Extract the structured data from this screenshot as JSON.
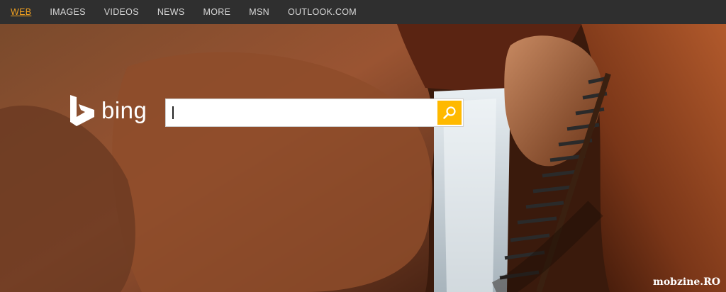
{
  "nav": {
    "items": [
      {
        "label": "WEB",
        "active": true
      },
      {
        "label": "IMAGES"
      },
      {
        "label": "VIDEOS"
      },
      {
        "label": "NEWS"
      },
      {
        "label": "MORE"
      },
      {
        "label": "MSN"
      },
      {
        "label": "OUTLOOK.COM"
      }
    ],
    "active_color": "#f0a020"
  },
  "logo": {
    "text": "bing",
    "icon": "bing-b-icon"
  },
  "search": {
    "value": "",
    "button_icon": "search-icon",
    "button_color": "#ffb900"
  },
  "watermark": "mobzine.RO"
}
